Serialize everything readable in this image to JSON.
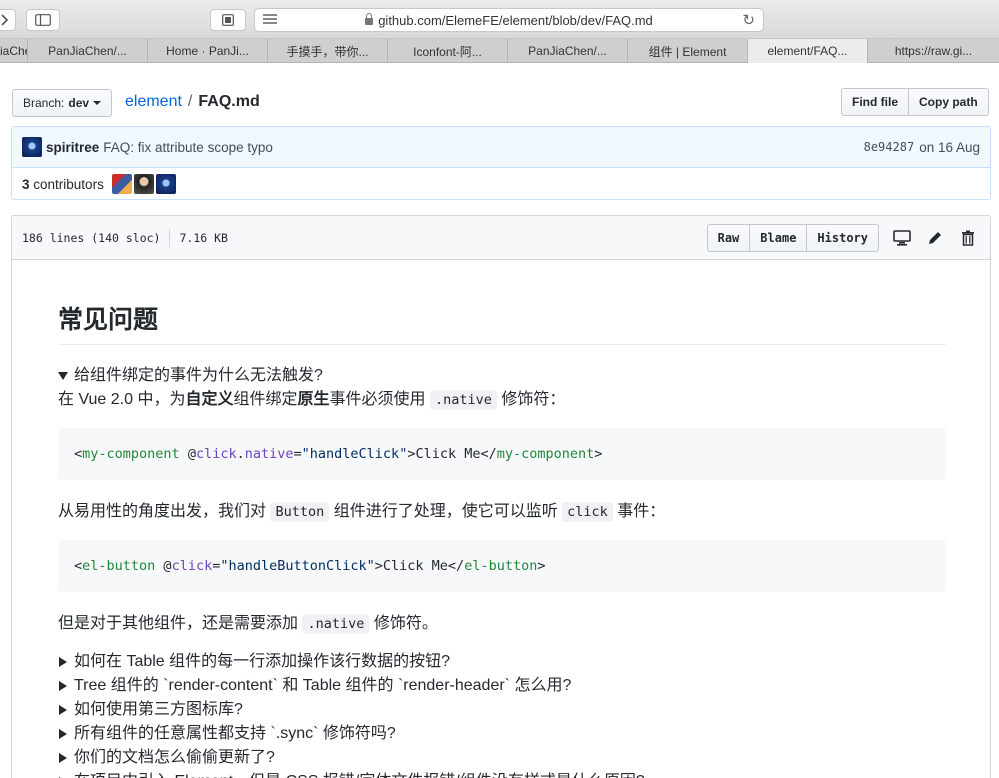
{
  "browser": {
    "url": "github.com/ElemeFE/element/blob/dev/FAQ.md",
    "tabs": [
      {
        "label": "iaChe"
      },
      {
        "label": "PanJiaChen/..."
      },
      {
        "label": "Home · PanJi..."
      },
      {
        "label": "手摸手，带你..."
      },
      {
        "label": "Iconfont-阿..."
      },
      {
        "label": "PanJiaChen/..."
      },
      {
        "label": "组件 | Element"
      },
      {
        "label": "element/FAQ...",
        "active": true
      },
      {
        "label": "https://raw.gi..."
      }
    ]
  },
  "repo_header": {
    "branch_label": "Branch:",
    "branch_name": "dev",
    "repo": "element",
    "separator": "/",
    "file": "FAQ.md",
    "find_file": "Find file",
    "copy_path": "Copy path"
  },
  "commit": {
    "author": "spiritree",
    "message": "FAQ: fix attribute scope typo",
    "sha": "8e94287",
    "date": "on 16 Aug",
    "contributors_count": "3",
    "contributors_label": "contributors"
  },
  "file": {
    "lines": "186 lines (140 sloc)",
    "size": "7.16 KB",
    "raw": "Raw",
    "blame": "Blame",
    "history": "History"
  },
  "content": {
    "h1": "常见问题",
    "q1_summary": "给组件绑定的事件为什么无法触发?",
    "p1_a": "在 Vue 2.0 中，为",
    "p1_b": "自定义",
    "p1_c": "组件绑定",
    "p1_d": "原生",
    "p1_e": "事件必须使用",
    "p1_code": ".native",
    "p1_f": "修饰符：",
    "code1": {
      "lt": "<",
      "tag": "my-component",
      "attr_prefix": " @",
      "attr": "click",
      "attr_dot": ".",
      "modifier": "native",
      "eq": "=",
      "value": "\"handleClick\"",
      "text": ">Click Me</",
      "close_tag": "my-component",
      "gt": ">"
    },
    "p2_a": "从易用性的角度出发，我们对",
    "p2_code1": "Button",
    "p2_b": "组件进行了处理，使它可以监听",
    "p2_code2": "click",
    "p2_c": "事件：",
    "code2": {
      "lt": "<",
      "tag": "el-button",
      "attr_prefix": " @",
      "attr": "click",
      "eq": "=",
      "value": "\"handleButtonClick\"",
      "text": ">Click Me</",
      "close_tag": "el-button",
      "gt": ">"
    },
    "p3_a": "但是对于其他组件，还是需要添加",
    "p3_code": ".native",
    "p3_b": "修饰符。",
    "faq": [
      "如何在 Table 组件的每一行添加操作该行数据的按钮?",
      "Tree 组件的 `render-content` 和 Table 组件的 `render-header` 怎么用?",
      "如何使用第三方图标库?",
      "所有组件的任意属性都支持 `.sync` 修饰符吗?",
      "你们的文档怎么偷偷更新了?",
      "在项目中引入 Element，但是 CSS 报错/字体文件报错/组件没有样式是什么原因?"
    ]
  }
}
